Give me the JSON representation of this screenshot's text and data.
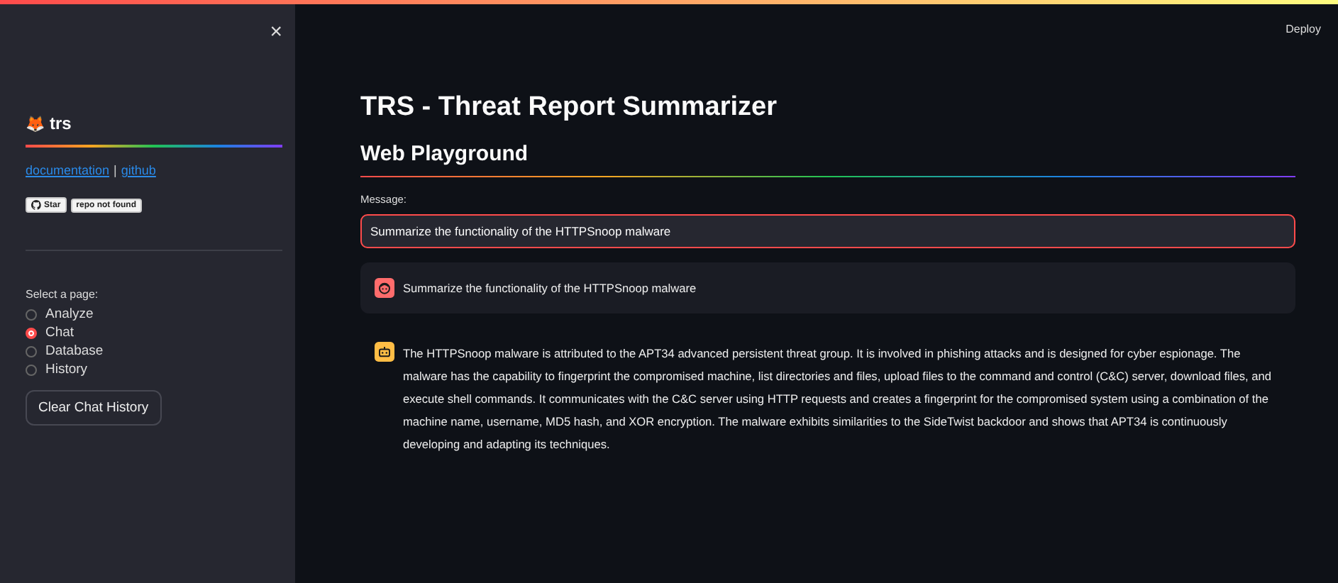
{
  "sidebar": {
    "close": "×",
    "brand": {
      "emoji": "🦊",
      "name": "trs"
    },
    "links": [
      {
        "label": "documentation"
      },
      {
        "label": "github"
      }
    ],
    "link_separator": "|",
    "badge": {
      "label": "Star",
      "value": "repo not found"
    },
    "radio": {
      "label": "Select a page:",
      "options": [
        {
          "label": "Analyze",
          "selected": false
        },
        {
          "label": "Chat",
          "selected": true
        },
        {
          "label": "Database",
          "selected": false
        },
        {
          "label": "History",
          "selected": false
        }
      ]
    },
    "button": "Clear Chat History"
  },
  "header": {
    "deploy": "Deploy"
  },
  "main": {
    "title": "TRS - Threat Report Summarizer",
    "subheader": "Web Playground",
    "input": {
      "label": "Message:",
      "value": "Summarize the functionality of the HTTPSnoop malware"
    },
    "messages": [
      {
        "kind": "user",
        "text": "Summarize the functionality of the HTTPSnoop malware"
      },
      {
        "kind": "assistant",
        "text": "The HTTPSnoop malware is attributed to the APT34 advanced persistent threat group. It is involved in phishing attacks and is designed for cyber espionage. The malware has the capability to fingerprint the compromised machine, list directories and files, upload files to the command and control (C&C) server, download files, and execute shell commands. It communicates with the C&C server using HTTP requests and creates a fingerprint for the compromised system using a combination of the machine name, username, MD5 hash, and XOR encryption. The malware exhibits similarities to the SideTwist backdoor and shows that APT34 is continuously developing and adapting its techniques."
      }
    ]
  }
}
